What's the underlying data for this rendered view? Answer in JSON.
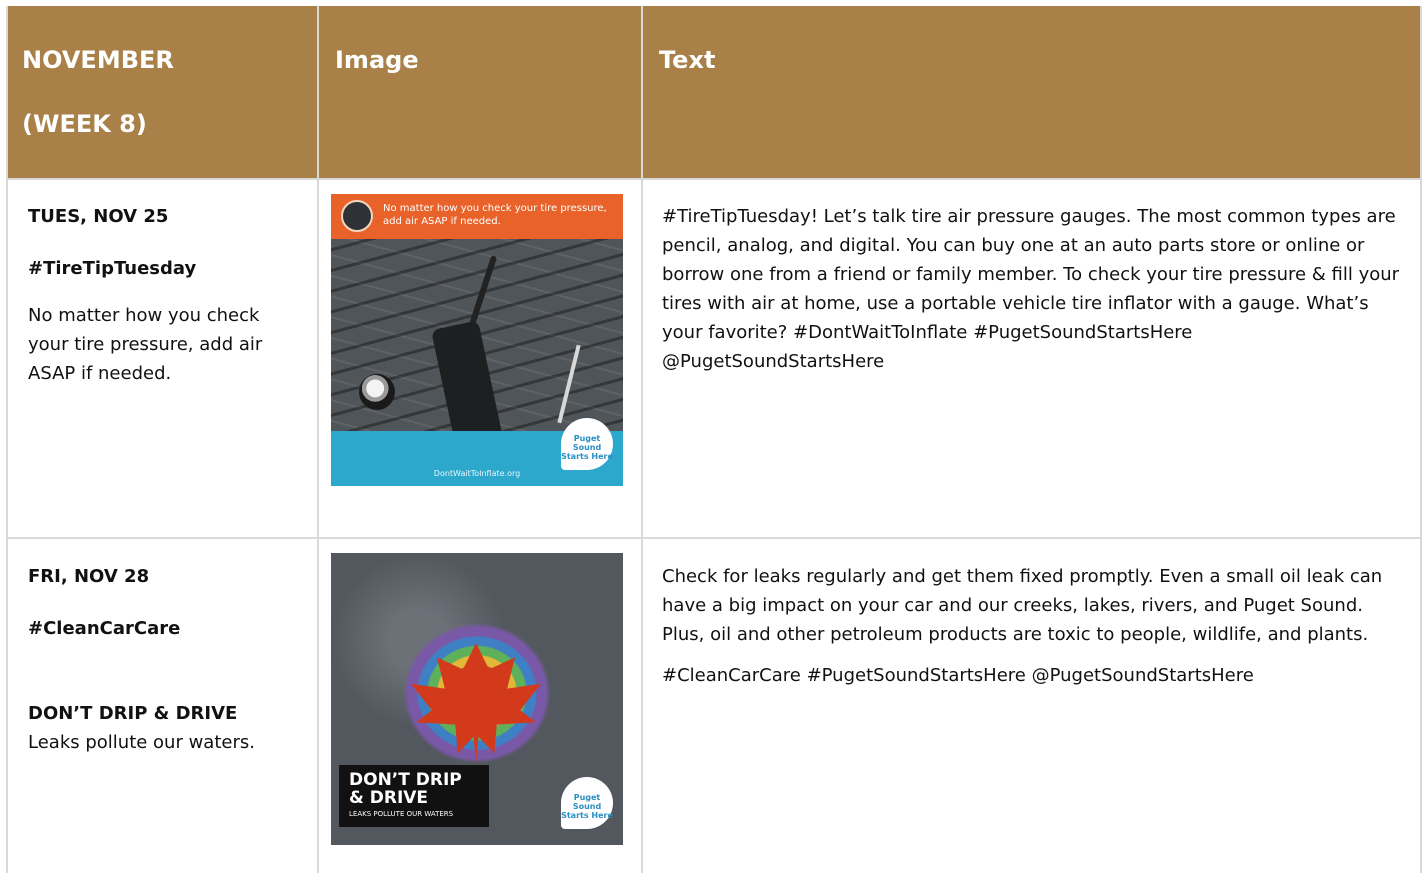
{
  "header": {
    "col1_line1": "NOVEMBER",
    "col1_line2": "(WEEK 8)",
    "col2": "Image",
    "col3": "Text"
  },
  "rows": [
    {
      "date": "TUES, NOV 25",
      "hashtag": "#TireTipTuesday",
      "caption": "No matter how you check your tire pressure, add air ASAP if needed.",
      "image": {
        "caption": "No matter how you check your tire pressure, add air ASAP if needed.",
        "url_text": "DontWaitToInflate.org",
        "logo_text": "Puget Sound Starts Here"
      },
      "text": "#TireTipTuesday! Let’s talk tire air pressure gauges. The most common types are pencil, analog, and digital. You can buy one at an auto parts store or online or borrow one from a friend or family member. To check your tire pressure & fill your tires with air at home, use a portable vehicle tire inflator with a gauge. What’s your favorite? #DontWaitToInflate #PugetSoundStartsHere @PugetSoundStartsHere"
    },
    {
      "date": "FRI, NOV 28",
      "hashtag": "#CleanCarCare",
      "headline": "DON’T DRIP & DRIVE",
      "caption": "Leaks pollute our waters.",
      "image": {
        "line1": "DON’T DRIP",
        "line2": "& DRIVE",
        "line3": "LEAKS POLLUTE OUR WATERS",
        "logo_text": "Puget Sound Starts Here"
      },
      "text_p1": "Check for leaks regularly and get them fixed promptly. Even a small oil leak can have a big impact on your car and our creeks, lakes, rivers, and Puget Sound. Plus, oil and other petroleum products are toxic to people, wildlife, and plants.",
      "text_p2": "#CleanCarCare #PugetSoundStartsHere @PugetSoundStartsHere"
    }
  ],
  "colors": {
    "header_bg": "#a98048",
    "grid": "#d9d9d9",
    "image1_banner": "#e8622a",
    "image1_footer": "#2ba8cc"
  }
}
